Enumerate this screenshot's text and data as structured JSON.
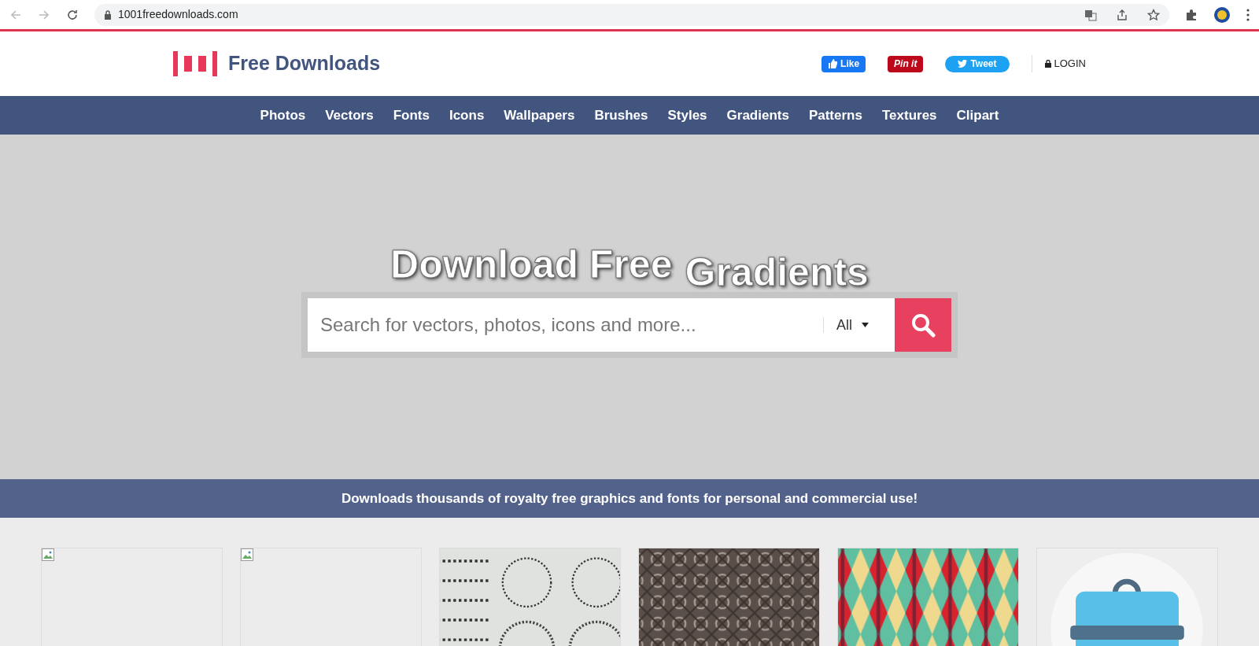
{
  "browser": {
    "url": "1001freedownloads.com"
  },
  "header": {
    "logo_text": "Free Downloads",
    "social": [
      {
        "kind": "like",
        "label": "Like"
      },
      {
        "kind": "pin",
        "label": "Pin it"
      },
      {
        "kind": "tweet",
        "label": "Tweet"
      }
    ],
    "login": "LOGIN"
  },
  "nav": [
    "Photos",
    "Vectors",
    "Fonts",
    "Icons",
    "Wallpapers",
    "Brushes",
    "Styles",
    "Gradients",
    "Patterns",
    "Textures",
    "Clipart"
  ],
  "hero": {
    "title": "Download Free",
    "rotating_word": "Gradients",
    "search": {
      "placeholder": "Search for vectors, photos, icons and more...",
      "category": "All"
    }
  },
  "banner": "Downloads thousands of royalty free graphics and fonts for personal and commercial use!",
  "tiles": [
    {
      "kind": "broken"
    },
    {
      "kind": "broken"
    },
    {
      "kind": "ornaments"
    },
    {
      "kind": "tiles"
    },
    {
      "kind": "diamonds"
    },
    {
      "kind": "bag"
    }
  ]
}
